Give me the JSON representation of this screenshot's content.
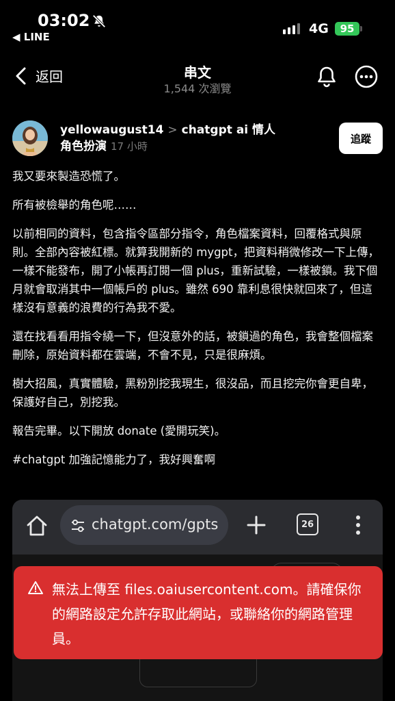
{
  "status_bar": {
    "time": "03:02",
    "back_app": "◀ LINE",
    "network": "4G",
    "battery": "95"
  },
  "header": {
    "back_label": "返回",
    "title": "串文",
    "views": "1,544 次瀏覽"
  },
  "post": {
    "username": "yellowaugust14",
    "separator": ">",
    "topic": "chatgpt ai 情人 角色扮演",
    "time": "17 小時",
    "follow_label": "追蹤",
    "paragraphs": [
      "我又要來製造恐慌了。",
      "所有被檢舉的角色呢……",
      "以前相同的資料，包含指令區部分指令，角色檔案資料，回覆格式與原則。全部內容被紅標。就算我開新的 mygpt，把資料稍微修改一下上傳，一樣不能發布，開了小帳再訂閱一個 plus，重新試驗，一樣被鎖。我下個月就會取消其中一個帳戶的 plus。雖然 690 靠利息很快就回來了，但這樣沒有意義的浪費的行為我不愛。",
      "還在找看看用指令繞一下，但沒意外的話，被鎖過的角色，我會整個檔案刪除，原始資料都在雲端，不會不見，只是很麻煩。",
      "樹大招風，真實體驗，黑粉別挖我現生，很沒品，而且挖完你會更自卑，保護好自己，別挖我。",
      "報告完畢。以下開放 donate (愛開玩笑)。",
      "#chatgpt 加強記憶能力了，我好興奮啊"
    ]
  },
  "screenshot": {
    "url": "chatgpt.com/gpts",
    "tab_count": "26",
    "error_message": "無法上傳至 files.oaiusercontent.com。請確保你的網路設定允許存取此網站，或聯絡你的網路管理員。"
  }
}
